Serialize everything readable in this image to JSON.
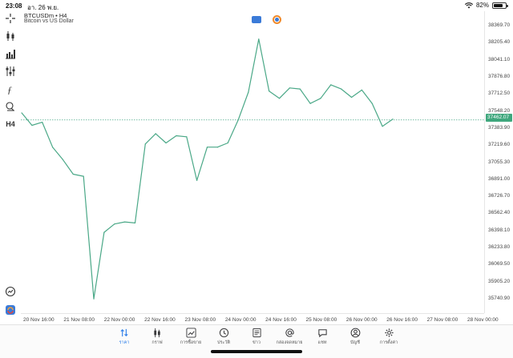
{
  "status": {
    "time": "23:08",
    "date": "อา. 26 พ.ย.",
    "battery": "82%",
    "battery_level": 0.82
  },
  "chart": {
    "symbol": "BTCUSDm • H4",
    "description": "Bitcoin vs US Dollar",
    "current_price": "37462.07",
    "line_color": "#4aa887",
    "accent_color": "#2b7de9"
  },
  "toolbar": {
    "tools": [
      "crosshair-icon",
      "candlestick-icon",
      "bar-chart-icon",
      "indicator-sliders-icon",
      "function-icon",
      "objects-icon"
    ],
    "timeframe": "H4"
  },
  "chart_data": {
    "type": "line",
    "x_labels": [
      "20 Nov 16:00",
      "21 Nov 08:00",
      "22 Nov 00:00",
      "22 Nov 16:00",
      "23 Nov 08:00",
      "24 Nov 00:00",
      "24 Nov 16:00",
      "25 Nov 08:00",
      "26 Nov 00:00",
      "26 Nov 16:00",
      "27 Nov 08:00",
      "28 Nov 00:00"
    ],
    "y_ticks": [
      "38369.70",
      "38205.40",
      "38041.10",
      "37876.80",
      "37712.50",
      "37548.20",
      "37383.90",
      "37219.60",
      "37055.30",
      "36891.00",
      "36726.70",
      "36562.40",
      "36398.10",
      "36233.80",
      "36069.50",
      "35905.20",
      "35740.90"
    ],
    "values": [
      37530,
      37410,
      37440,
      37200,
      37080,
      36940,
      36920,
      35740,
      36380,
      36460,
      36480,
      36470,
      37230,
      37330,
      37240,
      37310,
      37300,
      36880,
      37200,
      37200,
      37240,
      37460,
      37730,
      38240,
      37740,
      37670,
      37770,
      37760,
      37620,
      37670,
      37800,
      37760,
      37680,
      37750,
      37620,
      37400,
      37470
    ],
    "ylim": [
      35700,
      38450
    ],
    "current_price": 37462.07
  },
  "tabs": [
    {
      "label": "ราคา",
      "icon": "quotes-icon",
      "active": true
    },
    {
      "label": "กราฟ",
      "icon": "chart-icon",
      "active": false
    },
    {
      "label": "การซื้อขาย",
      "icon": "trade-icon",
      "active": false
    },
    {
      "label": "ประวัติ",
      "icon": "history-icon",
      "active": false
    },
    {
      "label": "ข่าว",
      "icon": "news-icon",
      "active": false
    },
    {
      "label": "กล่องจดหมาย",
      "icon": "mailbox-icon",
      "active": false
    },
    {
      "label": "แชท",
      "icon": "chat-icon",
      "active": false
    },
    {
      "label": "บัญชี",
      "icon": "account-icon",
      "active": false
    },
    {
      "label": "การตั้งค่า",
      "icon": "settings-icon",
      "active": false
    }
  ]
}
